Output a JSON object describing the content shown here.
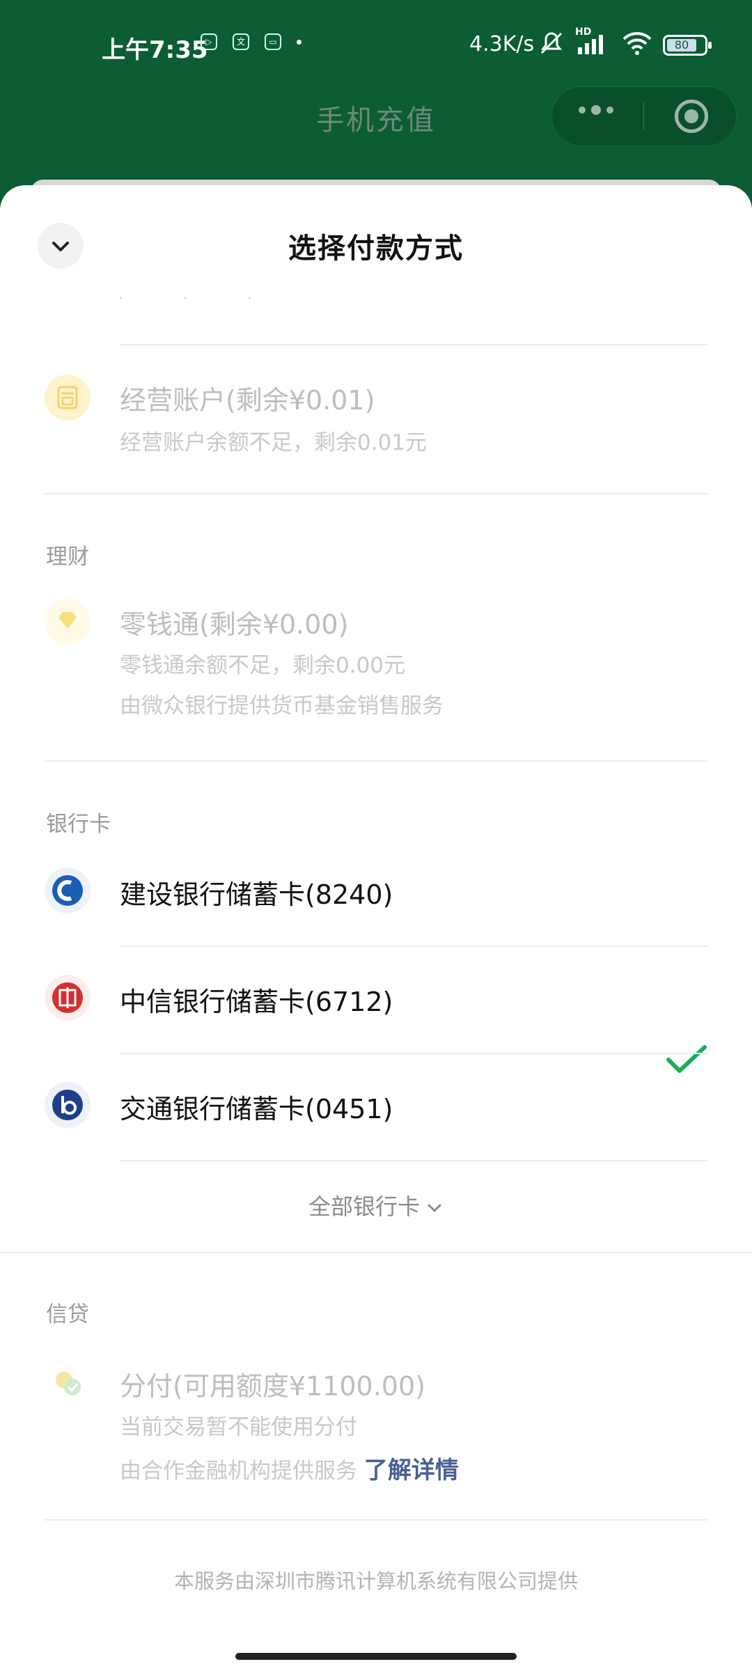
{
  "status_bar": {
    "time": "上午7:35",
    "net_speed": "4.3K/s",
    "signal_label": "HD",
    "battery": "80",
    "battery_level": 0.8
  },
  "header": {
    "title": "手机充值"
  },
  "sheet": {
    "title": "选择付款方式",
    "business_account": {
      "title": "经营账户(剩余¥0.01)",
      "subtitle": "经营账户余额不足，剩余0.01元"
    },
    "wealth_section_label": "理财",
    "lingqiantong": {
      "title": "零钱通(剩余¥0.00)",
      "subtitle1": "零钱通余额不足，剩余0.00元",
      "subtitle2": "由微众银行提供货币基金销售服务"
    },
    "bank_section_label": "银行卡",
    "banks": [
      {
        "name": "建设银行储蓄卡(8240)",
        "selected": true,
        "color": "#1a5fb4"
      },
      {
        "name": "中信银行储蓄卡(6712)",
        "selected": false,
        "color": "#d32f2f"
      },
      {
        "name": "交通银行储蓄卡(0451)",
        "selected": false,
        "color": "#1d3f8a"
      }
    ],
    "all_cards_label": "全部银行卡",
    "credit_section_label": "信贷",
    "fenfu": {
      "title": "分付(可用额度¥1100.00)",
      "subtitle1": "当前交易暂不能使用分付",
      "subtitle2": "由合作金融机构提供服务",
      "learn_more": "了解详情"
    },
    "footer": "本服务由深圳市腾讯计算机系统有限公司提供"
  },
  "colors": {
    "header_bg": "#0c5c34",
    "check": "#1aad5a",
    "link": "#4a5f93"
  }
}
